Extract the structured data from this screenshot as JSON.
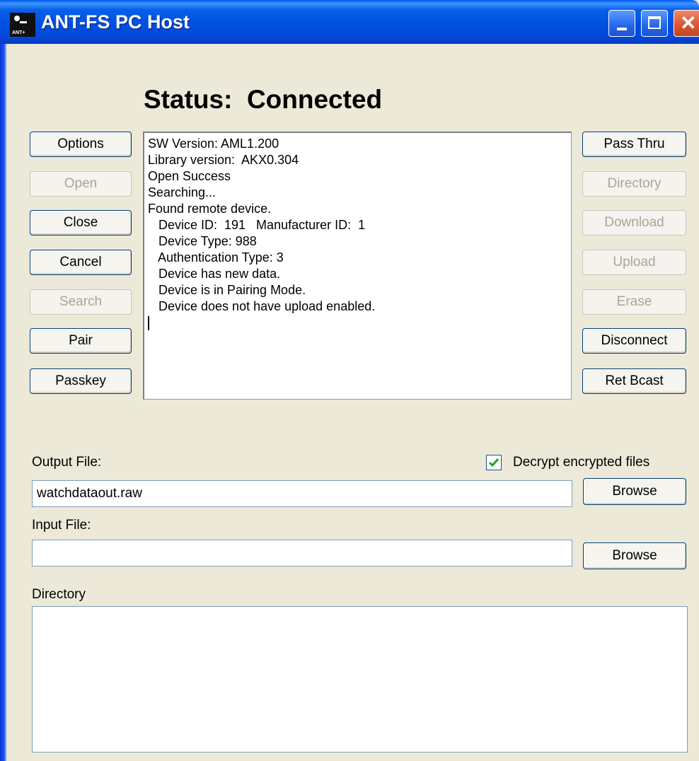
{
  "window": {
    "title": "ANT-FS PC Host",
    "icon_label": "ANT+"
  },
  "status": {
    "text": "Status:  Connected"
  },
  "left_buttons": [
    {
      "label": "Options",
      "disabled": false
    },
    {
      "label": "Open",
      "disabled": true
    },
    {
      "label": "Close",
      "disabled": false
    },
    {
      "label": "Cancel",
      "disabled": false
    },
    {
      "label": "Search",
      "disabled": true
    },
    {
      "label": "Pair",
      "disabled": false
    },
    {
      "label": "Passkey",
      "disabled": false
    }
  ],
  "right_buttons": [
    {
      "label": "Pass Thru",
      "disabled": false
    },
    {
      "label": "Directory",
      "disabled": true
    },
    {
      "label": "Download",
      "disabled": true
    },
    {
      "label": "Upload",
      "disabled": true
    },
    {
      "label": "Erase",
      "disabled": true
    },
    {
      "label": "Disconnect",
      "disabled": false
    },
    {
      "label": "Ret Bcast",
      "disabled": false
    }
  ],
  "log": [
    "SW Version: AML1.200",
    "Library version:  AKX0.304",
    "Open Success",
    "Searching...",
    "Found remote device.",
    "   Device ID:  191   Manufacturer ID:  1",
    "   Device Type: 988",
    "   Authentication Type: 3",
    "   Device has new data.",
    "   Device is in Pairing Mode.",
    "   Device does not have upload enabled."
  ],
  "output": {
    "label": "Output File:",
    "value": "watchdataout.raw",
    "browse_label": "Browse"
  },
  "decrypt": {
    "label": "Decrypt encrypted files",
    "checked": true
  },
  "input": {
    "label": "Input File:",
    "value": "",
    "browse_label": "Browse"
  },
  "directory": {
    "label": "Directory"
  }
}
